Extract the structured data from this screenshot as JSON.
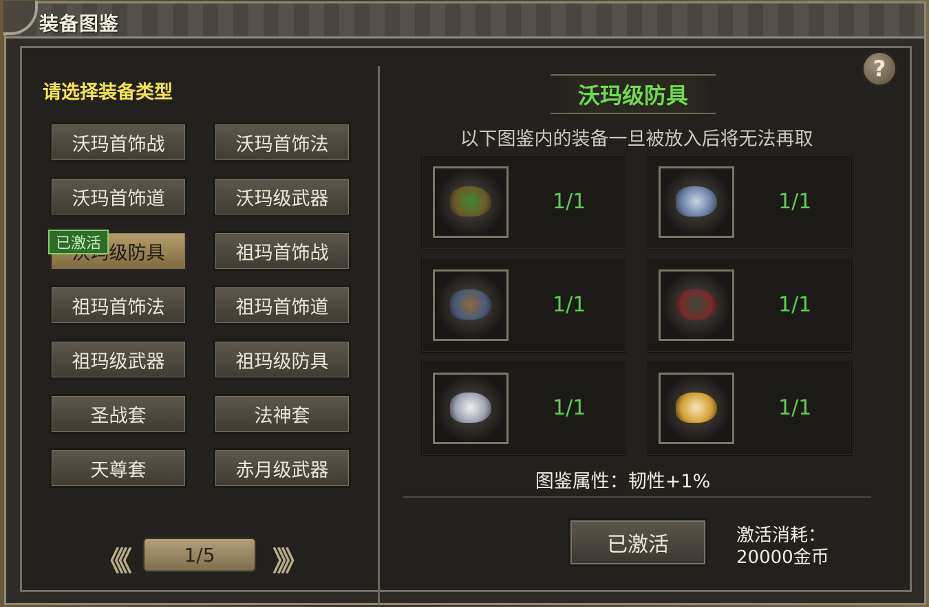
{
  "window": {
    "title": "装备图鉴"
  },
  "left_panel": {
    "subtitle": "请选择装备类型",
    "categories": [
      "沃玛首饰战",
      "沃玛首饰法",
      "沃玛首饰道",
      "沃玛级武器",
      "沃玛级防具",
      "祖玛首饰战",
      "祖玛首饰法",
      "祖玛首饰道",
      "祖玛级武器",
      "祖玛级防具",
      "圣战套",
      "法神套",
      "天尊套",
      "赤月级武器"
    ],
    "selected_index": 4,
    "active_badge": "已激活",
    "pager": {
      "prev": "《《",
      "page": "1/5",
      "next": "》》"
    }
  },
  "right_panel": {
    "help": "?",
    "set_title": "沃玛级防具",
    "notice": "以下图鉴内的装备一旦被放入后将无法再取",
    "slots": [
      {
        "count": "1/1",
        "icon": "armor-green-icon"
      },
      {
        "count": "1/1",
        "icon": "armor-silver-icon"
      },
      {
        "count": "1/1",
        "icon": "armor-bronze-icon"
      },
      {
        "count": "1/1",
        "icon": "armor-dark-icon"
      },
      {
        "count": "1/1",
        "icon": "armor-white-icon"
      },
      {
        "count": "1/1",
        "icon": "armor-gold-icon"
      }
    ],
    "attribute": "图鉴属性：韧性+1%",
    "activate_button": "已激活",
    "cost_label": "激活消耗：",
    "cost_value": "20000金币"
  },
  "colors": {
    "accent_green": "#5bd14a",
    "title_yellow": "#f5e44c"
  }
}
